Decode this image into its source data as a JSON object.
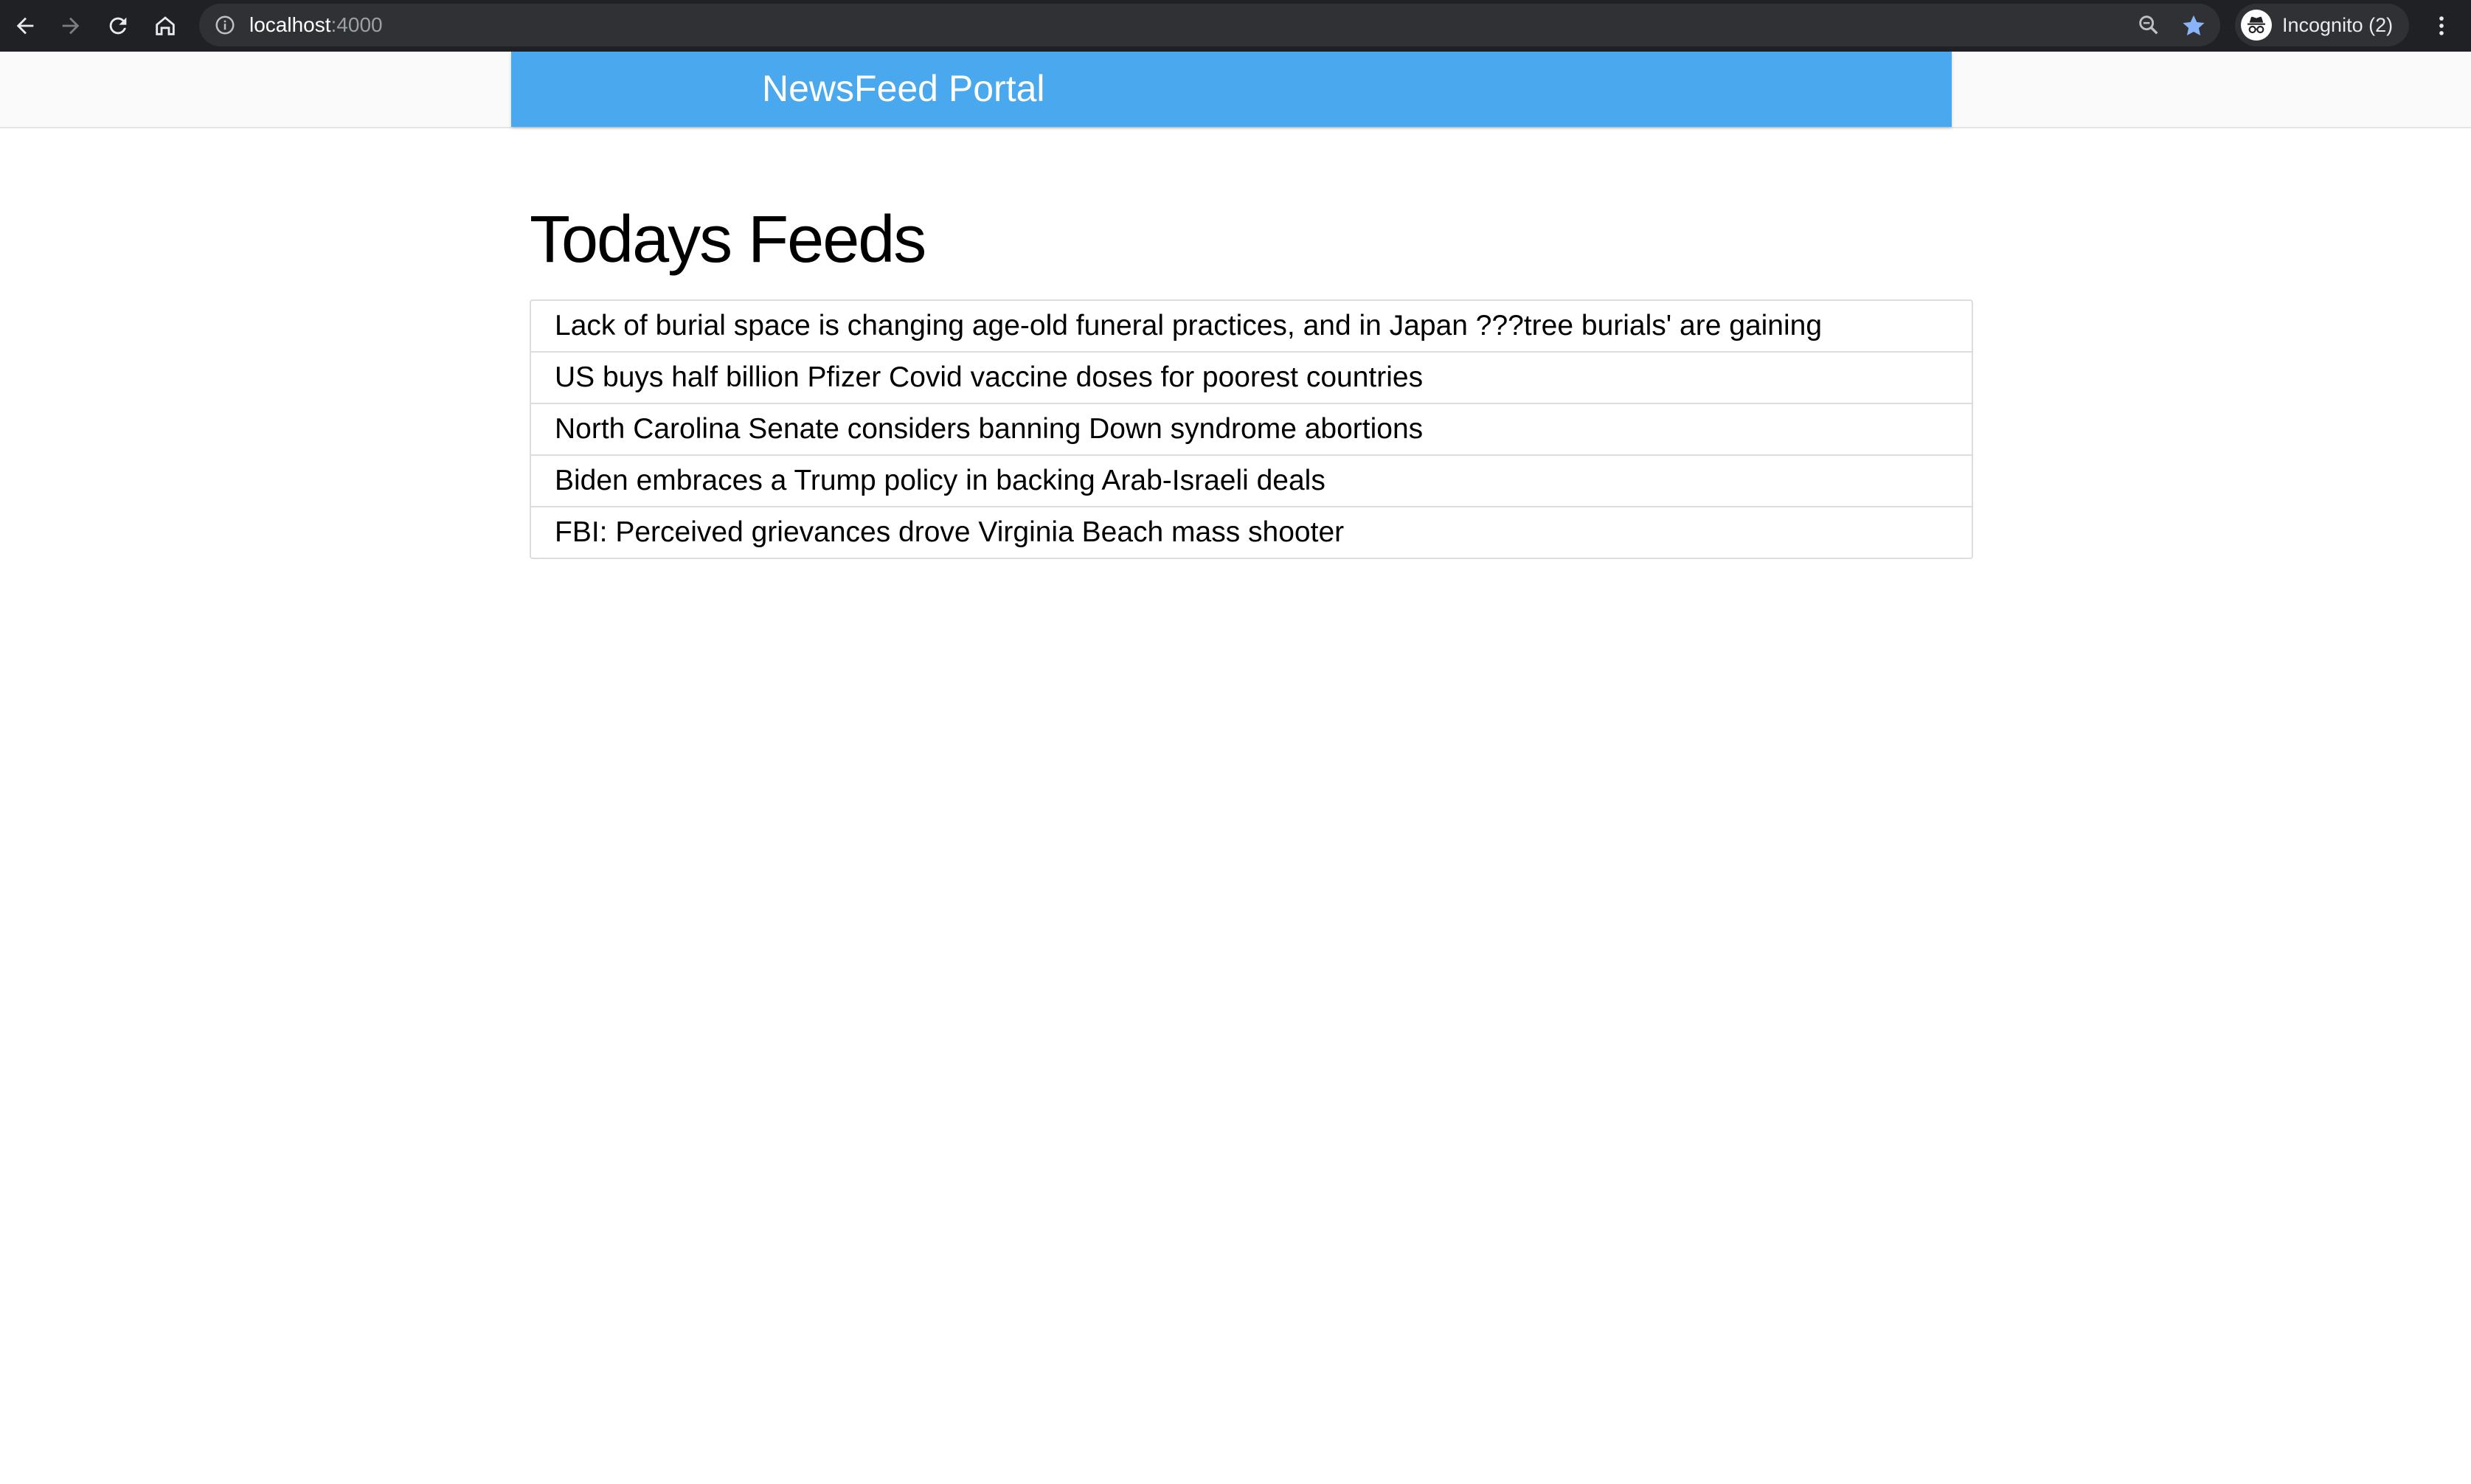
{
  "browser": {
    "url_host": "localhost",
    "url_port": ":4000",
    "profile_label": "Incognito (2)",
    "icons": {
      "back": "arrow-left-icon",
      "forward": "arrow-right-icon",
      "reload": "reload-icon",
      "home": "home-icon",
      "info": "info-icon",
      "zoom": "zoom-icon",
      "bookmark": "star-icon",
      "profile": "incognito-icon",
      "menu": "kebab-menu-icon"
    },
    "colors": {
      "chrome": "#202124",
      "omnibox": "#303134",
      "star": "#8ab4f8"
    }
  },
  "header": {
    "brand": "NewsFeed Portal",
    "color": "#4aa8ef"
  },
  "main": {
    "title": "Todays Feeds",
    "feeds": [
      "Lack of burial space is changing age-old funeral practices, and in Japan ???tree burials' are gaining",
      "US buys half billion Pfizer Covid vaccine doses for poorest countries",
      "North Carolina Senate considers banning Down syndrome abortions",
      "Biden embraces a Trump policy in backing Arab-Israeli deals",
      "FBI: Perceived grievances drove Virginia Beach mass shooter"
    ]
  }
}
